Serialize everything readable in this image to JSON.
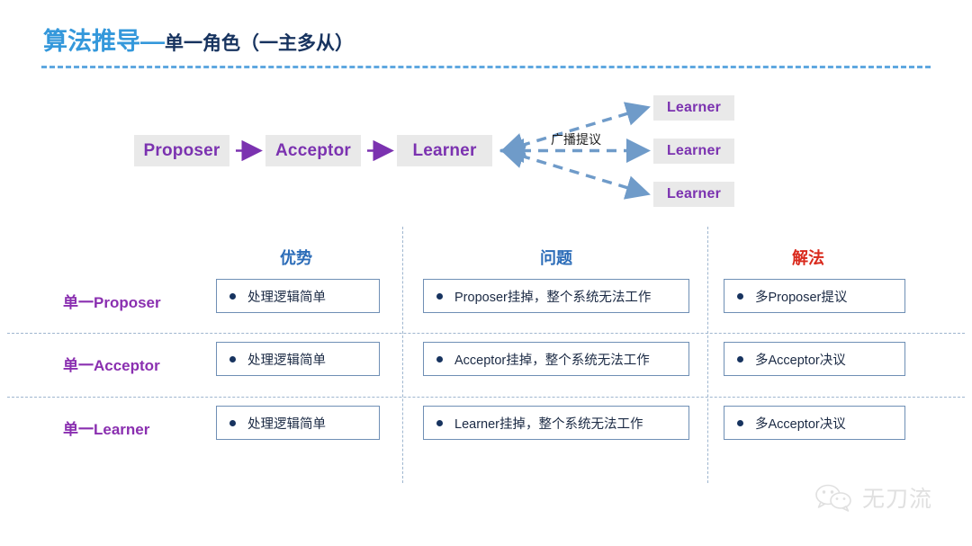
{
  "title": {
    "main": "算法推导",
    "dash": "—",
    "sub": "单一角色（一主多从）"
  },
  "colors": {
    "title_main": "#3498db",
    "title_sub": "#17335f",
    "rule": "#5fa8e0",
    "node_bg": "#e9e9e9",
    "node_text": "#7b32b0",
    "arrow_solid": "#7b32b0",
    "arrow_dashed": "#6f9bc9",
    "header_blue": "#2b6cb8",
    "header_red": "#d9291c",
    "row_label": "#8a2fb0",
    "cell_border": "#6f8fb5",
    "cell_text": "#1b2a44",
    "divider": "#9fb6cf"
  },
  "flow": {
    "nodes": [
      {
        "id": "proposer",
        "label": "Proposer"
      },
      {
        "id": "acceptor",
        "label": "Acceptor"
      },
      {
        "id": "learner",
        "label": "Learner"
      }
    ],
    "learners": [
      {
        "label": "Learner"
      },
      {
        "label": "Learner"
      },
      {
        "label": "Learner"
      }
    ],
    "broadcast_label": "广播提议"
  },
  "table": {
    "headers": [
      "优势",
      "问题",
      "解法"
    ],
    "rows": [
      {
        "label": "单一Proposer",
        "cells": [
          "处理逻辑简单",
          "Proposer挂掉，整个系统无法工作",
          "多Proposer提议"
        ]
      },
      {
        "label": "单一Acceptor",
        "cells": [
          "处理逻辑简单",
          "Acceptor挂掉，整个系统无法工作",
          "多Acceptor决议"
        ]
      },
      {
        "label": "单一Learner",
        "cells": [
          "处理逻辑简单",
          "Learner挂掉，整个系统无法工作",
          "多Acceptor决议"
        ]
      }
    ]
  },
  "watermark": {
    "text": "无刀流"
  }
}
